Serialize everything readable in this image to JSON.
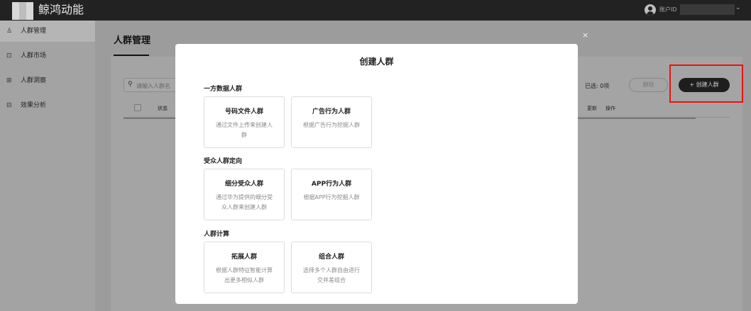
{
  "app": {
    "title": "鲸鸿动能"
  },
  "account": {
    "label": "账户ID",
    "id": "",
    "chevron": "⌄"
  },
  "sidebar": {
    "items": [
      {
        "label": "人群管理",
        "icon": "person-icon",
        "glyph": "♙",
        "active": true
      },
      {
        "label": "人群市场",
        "icon": "market-icon",
        "glyph": "⊡",
        "active": false
      },
      {
        "label": "人群洞察",
        "icon": "insight-icon",
        "glyph": "⊞",
        "active": false
      },
      {
        "label": "效果分析",
        "icon": "analysis-icon",
        "glyph": "⊟",
        "active": false
      }
    ]
  },
  "page": {
    "title": "人群管理",
    "search_placeholder": "请输入人群名",
    "columns": {
      "status": "状态",
      "update": "更新",
      "action": "操作"
    },
    "selected_text": "已选: 0项",
    "delete_label": "删除",
    "create_label": "+ 创建人群"
  },
  "modal": {
    "close_glyph": "×",
    "title": "创建人群",
    "sections": [
      {
        "title": "一方数据人群",
        "options": [
          {
            "title": "号码文件人群",
            "desc": "通过文件上传来创建人群"
          },
          {
            "title": "广告行为人群",
            "desc": "根据广告行为挖掘人群"
          }
        ]
      },
      {
        "title": "受众人群定向",
        "options": [
          {
            "title": "细分受众人群",
            "desc": "通过华为提供的细分受众人群来创建人群"
          },
          {
            "title": "APP行为人群",
            "desc": "根据APP行为挖掘人群"
          }
        ]
      },
      {
        "title": "人群计算",
        "options": [
          {
            "title": "拓展人群",
            "desc": "根据人群特征智能计算出更多相似人群"
          },
          {
            "title": "组合人群",
            "desc": "选择多个人群自由进行交并差组合"
          }
        ]
      }
    ]
  }
}
